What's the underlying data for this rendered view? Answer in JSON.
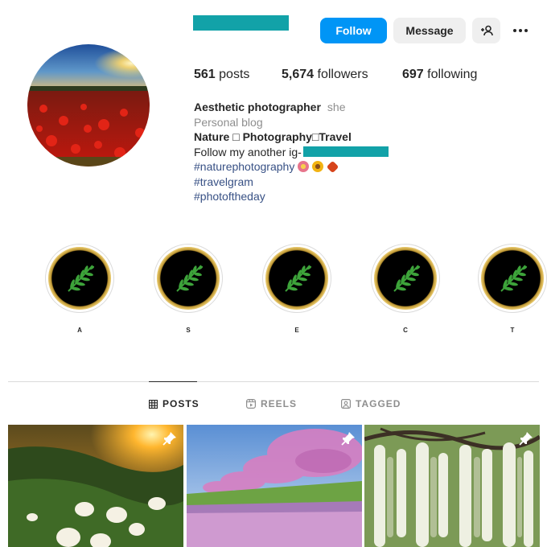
{
  "header": {
    "follow_label": "Follow",
    "message_label": "Message",
    "add_user_label": "+",
    "more_icon": "more-icon"
  },
  "stats": {
    "posts_count": "561",
    "posts_label": " posts",
    "followers_count": "5,674",
    "followers_label": " followers",
    "following_count": "697",
    "following_label": " following"
  },
  "bio": {
    "full_name": "Aesthetic photographer",
    "pronoun": "she",
    "category": "Personal blog",
    "line1": "Nature □ Photography□Travel",
    "line2_prefix": "Follow my another ig-",
    "hashtag1": "#naturephotography",
    "hashtag2": "#travelgram",
    "hashtag3": "#photoftheday"
  },
  "highlights": [
    {
      "label": "A"
    },
    {
      "label": "S"
    },
    {
      "label": "E"
    },
    {
      "label": "C"
    },
    {
      "label": "T"
    }
  ],
  "tabs": [
    {
      "label": "POSTS",
      "active": true
    },
    {
      "label": "REELS",
      "active": false
    },
    {
      "label": "TAGGED",
      "active": false
    }
  ],
  "colors": {
    "accent": "#0095f6",
    "redaction": "#12a2a8",
    "hashtag": "#385185"
  }
}
